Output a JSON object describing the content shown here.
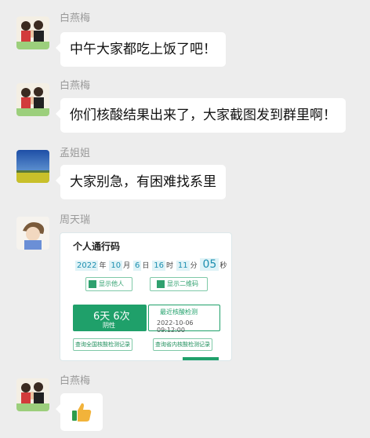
{
  "messages": [
    {
      "sender": "白燕梅",
      "text": "中午大家都吃上饭了吧！"
    },
    {
      "sender": "白燕梅",
      "text": "你们核酸结果出来了，大家截图发到群里啊！"
    },
    {
      "sender": "孟姐姐",
      "text": "大家别急，有困难找系里"
    },
    {
      "sender": "周天瑞"
    },
    {
      "sender": "白燕梅"
    }
  ],
  "card": {
    "title": "个人通行码",
    "year": "2022",
    "year_unit": "年",
    "month": "10",
    "month_unit": "月",
    "day": "6",
    "day_unit": "日",
    "hour": "16",
    "hour_unit": "时",
    "minute": "11",
    "minute_unit": "分",
    "second": "05",
    "second_unit": "秒",
    "show_other": "显示他人",
    "show_qr": "显示二维码",
    "days_status": "6天 6次",
    "days_sub": "阴性",
    "recent_test_label": "最近核酸检测",
    "recent_test_time": "2022-10-06 09:12:00",
    "query_national": "查询全国核酸检测记录",
    "query_province": "查询省内核酸检测记录"
  },
  "colors": {
    "background": "#ededed",
    "bubble": "#ffffff",
    "accent_green": "#1fa06a"
  }
}
